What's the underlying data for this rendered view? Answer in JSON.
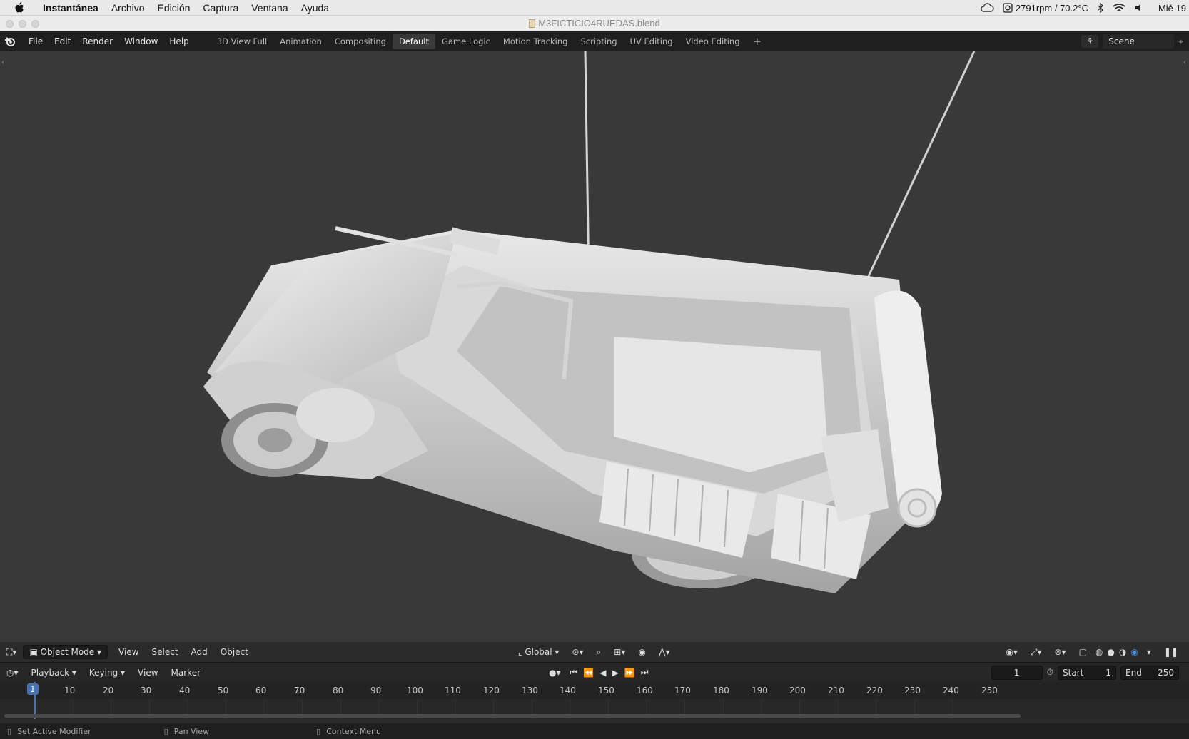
{
  "macos_menubar": {
    "app_name": "Instantánea",
    "menus": [
      "Archivo",
      "Edición",
      "Captura",
      "Ventana",
      "Ayuda"
    ],
    "status": {
      "fan_temp": "2791rpm / 70.2°C",
      "clock": "Mié 19"
    }
  },
  "window": {
    "title": "M3FICTICIO4RUEDAS.blend"
  },
  "topbar": {
    "menus": [
      "File",
      "Edit",
      "Render",
      "Window",
      "Help"
    ],
    "workspaces": [
      {
        "label": "3D View Full",
        "active": false
      },
      {
        "label": "Animation",
        "active": false
      },
      {
        "label": "Compositing",
        "active": false
      },
      {
        "label": "Default",
        "active": true
      },
      {
        "label": "Game Logic",
        "active": false
      },
      {
        "label": "Motion Tracking",
        "active": false
      },
      {
        "label": "Scripting",
        "active": false
      },
      {
        "label": "UV Editing",
        "active": false
      },
      {
        "label": "Video Editing",
        "active": false
      }
    ],
    "add_workspace": "+",
    "scene_name": "Scene"
  },
  "viewport_header": {
    "mode": "Object Mode",
    "menus": [
      "View",
      "Select",
      "Add",
      "Object"
    ],
    "transform_orientation": "Global"
  },
  "timeline": {
    "menus": [
      "Playback",
      "Keying",
      "View",
      "Marker"
    ],
    "current_frame": "1",
    "start_label": "Start",
    "start_value": "1",
    "end_label": "End",
    "end_value": "250",
    "ruler_labels": [
      "1",
      "10",
      "20",
      "30",
      "40",
      "50",
      "60",
      "70",
      "80",
      "90",
      "100",
      "110",
      "120",
      "130",
      "140",
      "150",
      "160",
      "170",
      "180",
      "190",
      "200",
      "210",
      "220",
      "230",
      "240",
      "250"
    ]
  },
  "statusbar": {
    "hints": [
      "Set Active Modifier",
      "Pan View",
      "Context Menu"
    ]
  },
  "colors": {
    "accent": "#4772b3",
    "active_frame": "#4a7fd4"
  }
}
